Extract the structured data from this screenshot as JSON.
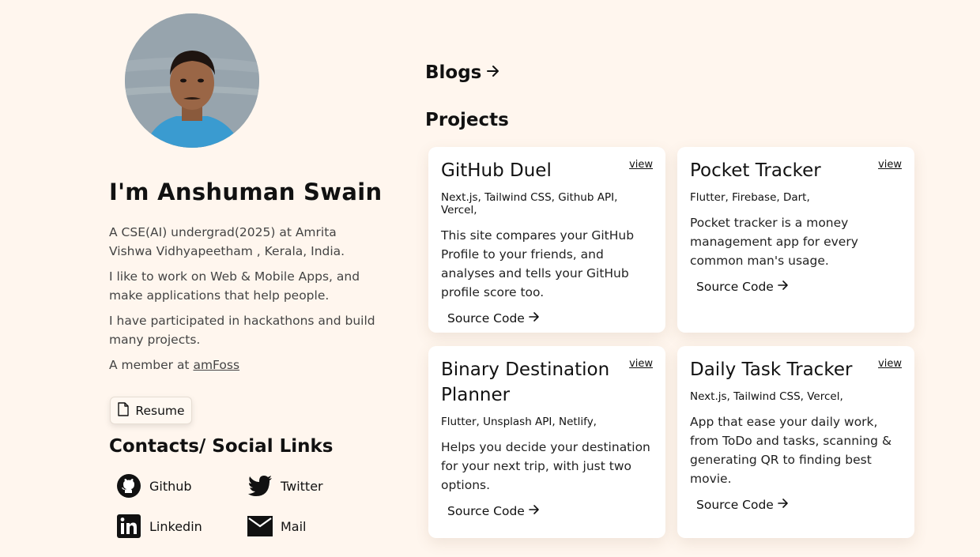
{
  "profile": {
    "name": "I'm Anshuman Swain",
    "bio1": "A CSE(AI) undergrad(2025) at Amrita Vishwa Vidhyapeetham , Kerala, India.",
    "bio2": "I like to work on Web & Mobile Apps, and make applications that help people.",
    "bio3": "I have participated in hackathons and build many projects.",
    "bio4_prefix": "A member at ",
    "bio4_link": "amFoss",
    "resume_label": "Resume"
  },
  "contacts": {
    "title": "Contacts/ Social Links",
    "items": [
      {
        "label": "Github",
        "icon": "github-icon"
      },
      {
        "label": "Twitter",
        "icon": "twitter-icon"
      },
      {
        "label": "Linkedin",
        "icon": "linkedin-icon"
      },
      {
        "label": "Mail",
        "icon": "mail-icon"
      }
    ]
  },
  "blogs_label": "Blogs",
  "projects": {
    "title": "Projects",
    "view_label": "view",
    "source_label": "Source Code",
    "items": [
      {
        "title": "GitHub Duel",
        "tech": "Next.js, Tailwind CSS, Github API, Vercel,",
        "desc": "This site compares your GitHub Profile to your friends, and analyses and tells your GitHub profile score too."
      },
      {
        "title": "Pocket Tracker",
        "tech": "Flutter, Firebase, Dart,",
        "desc": "Pocket tracker is a money management app for every common man's usage."
      },
      {
        "title": "Binary Destination Planner",
        "tech": "Flutter, Unsplash API, Netlify,",
        "desc": "Helps you decide your destination for your next trip, with just two options."
      },
      {
        "title": "Daily Task Tracker",
        "tech": "Next.js, Tailwind CSS, Vercel,",
        "desc": "App that ease your daily work, from ToDo and tasks, scanning & generating QR to finding best movie."
      }
    ]
  }
}
